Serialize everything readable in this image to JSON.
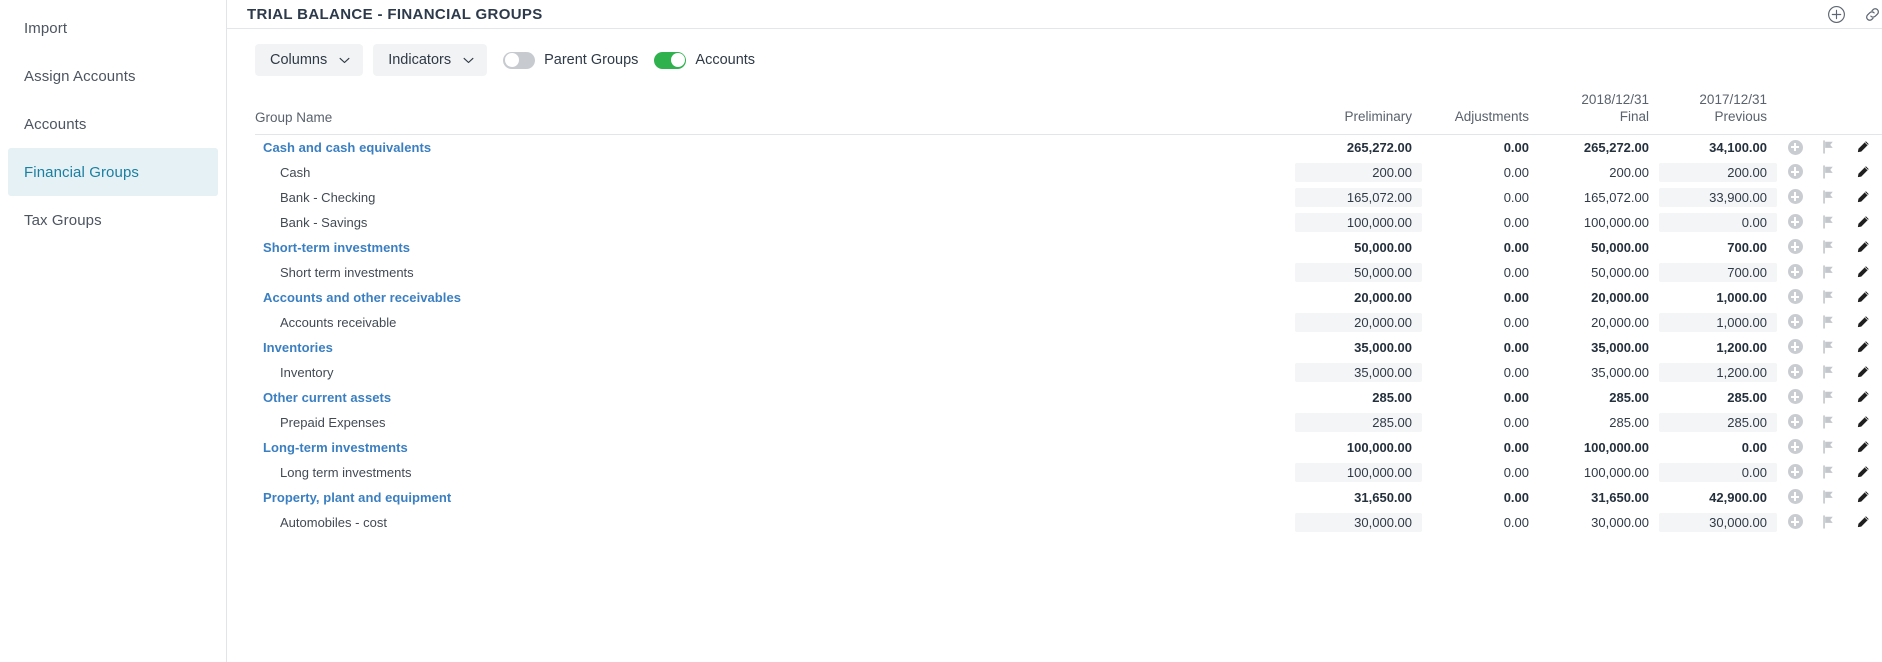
{
  "sidebar": {
    "items": [
      {
        "label": "Import",
        "active": false
      },
      {
        "label": "Assign Accounts",
        "active": false
      },
      {
        "label": "Accounts",
        "active": false
      },
      {
        "label": "Financial Groups",
        "active": true
      },
      {
        "label": "Tax Groups",
        "active": false
      }
    ]
  },
  "header": {
    "title": "TRIAL BALANCE - FINANCIAL GROUPS",
    "add_icon": "plus-circle-icon",
    "link_icon": "link-icon"
  },
  "toolbar": {
    "columns_label": "Columns",
    "indicators_label": "Indicators",
    "parent_groups_label": "Parent Groups",
    "parent_groups_on": false,
    "accounts_label": "Accounts",
    "accounts_on": true,
    "toggle_on_color": "#2fb14e",
    "toggle_off_color": "#c7cbd0"
  },
  "table": {
    "columns": {
      "name": "Group Name",
      "preliminary": "Preliminary",
      "adjustments": "Adjustments",
      "final_date": "2018/12/31",
      "final_sub": "Final",
      "previous_date": "2017/12/31",
      "previous_sub": "Previous"
    },
    "row_actions": {
      "add": "plus-circle-icon",
      "flag": "flag-icon",
      "edit": "pencil-icon"
    },
    "group_color": "#3a7fc1",
    "account_color": "#424a54",
    "rows": [
      {
        "type": "group",
        "name": "Cash and cash equivalents",
        "preliminary": "265,272.00",
        "adjustments": "0.00",
        "final": "265,272.00",
        "previous": "34,100.00"
      },
      {
        "type": "account",
        "name": "Cash",
        "preliminary": "200.00",
        "adjustments": "0.00",
        "final": "200.00",
        "previous": "200.00"
      },
      {
        "type": "account",
        "name": "Bank - Checking",
        "preliminary": "165,072.00",
        "adjustments": "0.00",
        "final": "165,072.00",
        "previous": "33,900.00"
      },
      {
        "type": "account",
        "name": "Bank - Savings",
        "preliminary": "100,000.00",
        "adjustments": "0.00",
        "final": "100,000.00",
        "previous": "0.00"
      },
      {
        "type": "group",
        "name": "Short-term investments",
        "preliminary": "50,000.00",
        "adjustments": "0.00",
        "final": "50,000.00",
        "previous": "700.00"
      },
      {
        "type": "account",
        "name": "Short term investments",
        "preliminary": "50,000.00",
        "adjustments": "0.00",
        "final": "50,000.00",
        "previous": "700.00"
      },
      {
        "type": "group",
        "name": "Accounts and other receivables",
        "preliminary": "20,000.00",
        "adjustments": "0.00",
        "final": "20,000.00",
        "previous": "1,000.00"
      },
      {
        "type": "account",
        "name": "Accounts receivable",
        "preliminary": "20,000.00",
        "adjustments": "0.00",
        "final": "20,000.00",
        "previous": "1,000.00"
      },
      {
        "type": "group",
        "name": "Inventories",
        "preliminary": "35,000.00",
        "adjustments": "0.00",
        "final": "35,000.00",
        "previous": "1,200.00"
      },
      {
        "type": "account",
        "name": "Inventory",
        "preliminary": "35,000.00",
        "adjustments": "0.00",
        "final": "35,000.00",
        "previous": "1,200.00"
      },
      {
        "type": "group",
        "name": "Other current assets",
        "preliminary": "285.00",
        "adjustments": "0.00",
        "final": "285.00",
        "previous": "285.00"
      },
      {
        "type": "account",
        "name": "Prepaid Expenses",
        "preliminary": "285.00",
        "adjustments": "0.00",
        "final": "285.00",
        "previous": "285.00"
      },
      {
        "type": "group",
        "name": "Long-term investments",
        "preliminary": "100,000.00",
        "adjustments": "0.00",
        "final": "100,000.00",
        "previous": "0.00"
      },
      {
        "type": "account",
        "name": "Long term investments",
        "preliminary": "100,000.00",
        "adjustments": "0.00",
        "final": "100,000.00",
        "previous": "0.00"
      },
      {
        "type": "group",
        "name": "Property, plant and equipment",
        "preliminary": "31,650.00",
        "adjustments": "0.00",
        "final": "31,650.00",
        "previous": "42,900.00"
      },
      {
        "type": "account",
        "name": "Automobiles - cost",
        "preliminary": "30,000.00",
        "adjustments": "0.00",
        "final": "30,000.00",
        "previous": "30,000.00"
      }
    ]
  }
}
